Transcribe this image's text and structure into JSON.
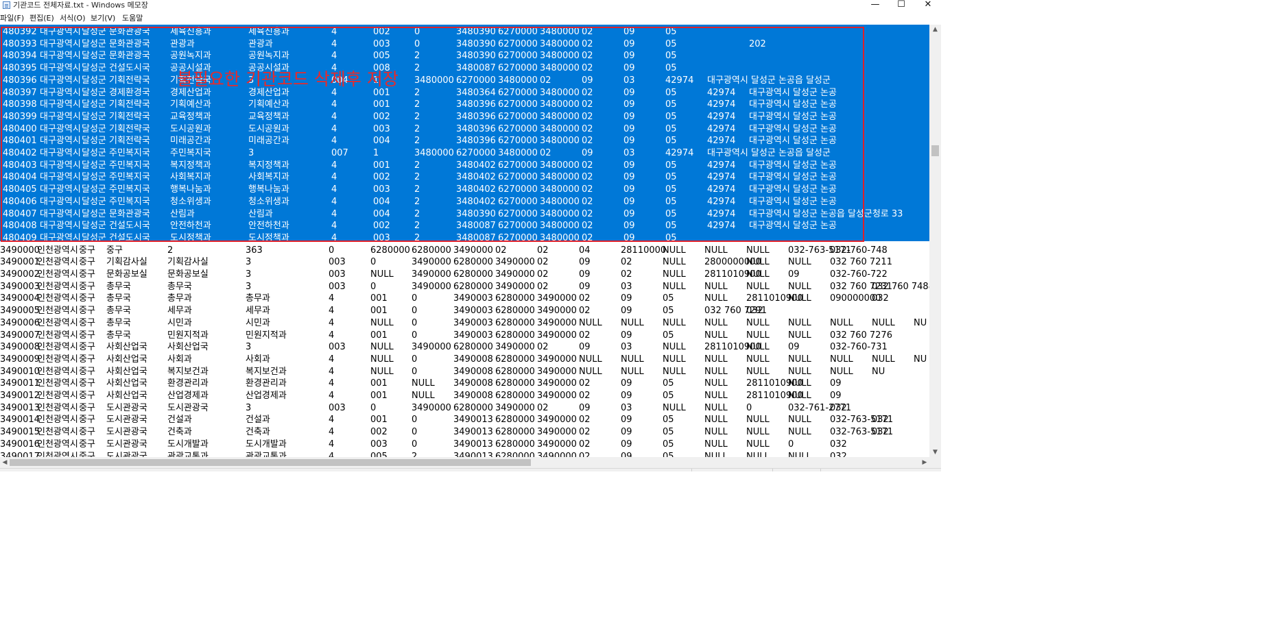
{
  "window": {
    "title": "기관코드 전체자료.txt - Windows 메모장",
    "controls": {
      "minimize": "—",
      "maximize": "☐",
      "close": "✕"
    }
  },
  "menu": [
    "파일(F)",
    "편집(E)",
    "서식(O)",
    "보기(V)",
    "도움말"
  ],
  "annotation": {
    "text": "불필요한 기관코드 삭제후 저장",
    "color": "#e0202a"
  },
  "colors": {
    "selection": "#0078d7",
    "annotation_border": "#e0202a"
  },
  "rows": [
    [
      "480392",
      "대구광역시",
      "달성군",
      "문화관광국",
      "세육진흥과",
      "세육진흥과",
      "4",
      "002",
      "0",
      "3480390",
      "6270000",
      "3480000",
      "02",
      "09",
      "05"
    ],
    [
      "480393",
      "대구광역시",
      "달성군",
      "문화관광국",
      "관광과",
      "관광과",
      "4",
      "003",
      "0",
      "3480390",
      "6270000",
      "3480000",
      "02",
      "09",
      "05",
      "",
      "202"
    ],
    [
      "480394",
      "대구광역시",
      "달성군",
      "문화관광국",
      "공원녹지과",
      "공원녹지과",
      "4",
      "005",
      "2",
      "3480390",
      "6270000",
      "3480000",
      "02",
      "09",
      "05"
    ],
    [
      "480395",
      "대구광역시",
      "달성군",
      "건설도시국",
      "공공시설과",
      "공공시설과",
      "4",
      "008",
      "2",
      "3480087",
      "6270000",
      "3480000",
      "02",
      "09",
      "05"
    ],
    [
      "480396",
      "대구광역시",
      "달성군",
      "기획전략국",
      "기획전략국",
      "3",
      "004",
      "1",
      "3480000",
      "6270000",
      "3480000",
      "02",
      "09",
      "03",
      "42974",
      "대구광역시 달성군 논공읍 달성군"
    ],
    [
      "480397",
      "대구광역시",
      "달성군",
      "경제환경국",
      "경제산업과",
      "경제산업과",
      "4",
      "001",
      "2",
      "3480364",
      "6270000",
      "3480000",
      "02",
      "09",
      "05",
      "42974",
      "대구광역시 달성군 논공"
    ],
    [
      "480398",
      "대구광역시",
      "달성군",
      "기획전략국",
      "기획예산과",
      "기획예산과",
      "4",
      "001",
      "2",
      "3480396",
      "6270000",
      "3480000",
      "02",
      "09",
      "05",
      "42974",
      "대구광역시 달성군 논공"
    ],
    [
      "480399",
      "대구광역시",
      "달성군",
      "기획전략국",
      "교육정책과",
      "교육정책과",
      "4",
      "002",
      "2",
      "3480396",
      "6270000",
      "3480000",
      "02",
      "09",
      "05",
      "42974",
      "대구광역시 달성군 논공"
    ],
    [
      "480400",
      "대구광역시",
      "달성군",
      "기획전략국",
      "도시공원과",
      "도시공원과",
      "4",
      "003",
      "2",
      "3480396",
      "6270000",
      "3480000",
      "02",
      "09",
      "05",
      "42974",
      "대구광역시 달성군 논공"
    ],
    [
      "480401",
      "대구광역시",
      "달성군",
      "기획전략국",
      "미래공간과",
      "미래공간과",
      "4",
      "004",
      "2",
      "3480396",
      "6270000",
      "3480000",
      "02",
      "09",
      "05",
      "42974",
      "대구광역시 달성군 논공"
    ],
    [
      "480402",
      "대구광역시",
      "달성군",
      "주민복지국",
      "주민복지국",
      "3",
      "007",
      "1",
      "3480000",
      "6270000",
      "3480000",
      "02",
      "09",
      "03",
      "42974",
      "대구광역시 달성군 논공읍 달성군"
    ],
    [
      "480403",
      "대구광역시",
      "달성군",
      "주민복지국",
      "복지정책과",
      "복지정책과",
      "4",
      "001",
      "2",
      "3480402",
      "6270000",
      "3480000",
      "02",
      "09",
      "05",
      "42974",
      "대구광역시 달성군 논공"
    ],
    [
      "480404",
      "대구광역시",
      "달성군",
      "주민복지국",
      "사회복지과",
      "사회복지과",
      "4",
      "002",
      "2",
      "3480402",
      "6270000",
      "3480000",
      "02",
      "09",
      "05",
      "42974",
      "대구광역시 달성군 논공"
    ],
    [
      "480405",
      "대구광역시",
      "달성군",
      "주민복지국",
      "행복나눔과",
      "행복나눔과",
      "4",
      "003",
      "2",
      "3480402",
      "6270000",
      "3480000",
      "02",
      "09",
      "05",
      "42974",
      "대구광역시 달성군 논공"
    ],
    [
      "480406",
      "대구광역시",
      "달성군",
      "주민복지국",
      "청소위생과",
      "청소위생과",
      "4",
      "004",
      "2",
      "3480402",
      "6270000",
      "3480000",
      "02",
      "09",
      "05",
      "42974",
      "대구광역시 달성군 논공"
    ],
    [
      "480407",
      "대구광역시",
      "달성군",
      "문화관광국",
      "산림과",
      "산림과",
      "4",
      "004",
      "2",
      "3480390",
      "6270000",
      "3480000",
      "02",
      "09",
      "05",
      "42974",
      "대구광역시 달성군 논공읍 달성군청로 33"
    ],
    [
      "480408",
      "대구광역시",
      "달성군",
      "건설도시국",
      "안전하천과",
      "안전하천과",
      "4",
      "002",
      "2",
      "3480087",
      "6270000",
      "3480000",
      "02",
      "09",
      "05",
      "42974",
      "대구광역시 달성군 논공"
    ],
    [
      "480409",
      "대구광역시",
      "달성군",
      "건설도시국",
      "도시정책과",
      "도시정책과",
      "4",
      "003",
      "2",
      "3480087",
      "6270000",
      "3480000",
      "02",
      "09",
      "05"
    ],
    [
      "3490000",
      "인천광역시",
      "중구",
      "중구",
      "2",
      "363",
      "0",
      "6280000",
      "6280000",
      "3490000",
      "02",
      "02",
      "04",
      "28110000",
      "NULL",
      "NULL",
      "NULL",
      "032-763-5171",
      "032-760-748"
    ],
    [
      "3490001",
      "인천광역시",
      "중구",
      "기획감사실",
      "기획감사실",
      "3",
      "003",
      "0",
      "3490000",
      "6280000",
      "3490000",
      "02",
      "09",
      "02",
      "NULL",
      "2800000000",
      "NULL",
      "NULL",
      "032 760 7211"
    ],
    [
      "3490002",
      "인천광역시",
      "중구",
      "문화공보실",
      "문화공보실",
      "3",
      "003",
      "NULL",
      "3490000",
      "6280000",
      "3490000",
      "02",
      "09",
      "02",
      "NULL",
      "2811010900",
      "NULL",
      "09",
      "032-760-722"
    ],
    [
      "3490003",
      "인천광역시",
      "중구",
      "총무국",
      "총무국",
      "3",
      "003",
      "0",
      "3490000",
      "6280000",
      "3490000",
      "02",
      "09",
      "03",
      "NULL",
      "NULL",
      "NULL",
      "NULL",
      "032 760 7231",
      "032 760 7488"
    ],
    [
      "3490004",
      "인천광역시",
      "중구",
      "총무국",
      "총무과",
      "총무과",
      "4",
      "001",
      "0",
      "3490003",
      "6280000",
      "3490000",
      "02",
      "09",
      "05",
      "NULL",
      "2811010900",
      "NULL",
      "090000000",
      "032"
    ],
    [
      "3490005",
      "인천광역시",
      "중구",
      "총무국",
      "세무과",
      "세무과",
      "4",
      "001",
      "0",
      "3490003",
      "6280000",
      "3490000",
      "02",
      "09",
      "05",
      "032 760 7291",
      "032"
    ],
    [
      "3490006",
      "인천광역시",
      "중구",
      "총무국",
      "시민과",
      "시민과",
      "4",
      "NULL",
      "0",
      "3490003",
      "6280000",
      "3490000",
      "NULL",
      "NULL",
      "NULL",
      "NULL",
      "NULL",
      "NULL",
      "NULL",
      "NULL",
      "NU"
    ],
    [
      "3490007",
      "인천광역시",
      "중구",
      "총무국",
      "민원지적과",
      "민원지적과",
      "4",
      "001",
      "0",
      "3490003",
      "6280000",
      "3490000",
      "02",
      "09",
      "05",
      "NULL",
      "NULL",
      "NULL",
      "032 760 7276"
    ],
    [
      "3490008",
      "인천광역시",
      "중구",
      "사회산업국",
      "사회산업국",
      "3",
      "003",
      "NULL",
      "3490000",
      "6280000",
      "3490000",
      "02",
      "09",
      "03",
      "NULL",
      "2811010900",
      "NULL",
      "09",
      "032-760-731"
    ],
    [
      "3490009",
      "인천광역시",
      "중구",
      "사회산업국",
      "사회과",
      "사회과",
      "4",
      "NULL",
      "0",
      "3490008",
      "6280000",
      "3490000",
      "NULL",
      "NULL",
      "NULL",
      "NULL",
      "NULL",
      "NULL",
      "NULL",
      "NULL",
      "NU"
    ],
    [
      "3490010",
      "인천광역시",
      "중구",
      "사회산업국",
      "복지보건과",
      "복지보건과",
      "4",
      "NULL",
      "0",
      "3490008",
      "6280000",
      "3490000",
      "NULL",
      "NULL",
      "NULL",
      "NULL",
      "NULL",
      "NULL",
      "NULL",
      "NU"
    ],
    [
      "3490011",
      "인천광역시",
      "중구",
      "사회산업국",
      "환경관리과",
      "환경관리과",
      "4",
      "001",
      "NULL",
      "3490008",
      "6280000",
      "3490000",
      "02",
      "09",
      "05",
      "NULL",
      "2811010900",
      "NULL",
      "09"
    ],
    [
      "3490012",
      "인천광역시",
      "중구",
      "사회산업국",
      "산업경제과",
      "산업경제과",
      "4",
      "001",
      "NULL",
      "3490008",
      "6280000",
      "3490000",
      "02",
      "09",
      "05",
      "NULL",
      "2811010900",
      "NULL",
      "09"
    ],
    [
      "3490013",
      "인천광역시",
      "중구",
      "도시관광국",
      "도시관광국",
      "3",
      "003",
      "0",
      "3490000",
      "6280000",
      "3490000",
      "02",
      "09",
      "03",
      "NULL",
      "NULL",
      "0",
      "032-761-2771",
      "032"
    ],
    [
      "3490014",
      "인천광역시",
      "중구",
      "도시관광국",
      "건설과",
      "건설과",
      "4",
      "001",
      "0",
      "3490013",
      "6280000",
      "3490000",
      "02",
      "09",
      "05",
      "NULL",
      "NULL",
      "NULL",
      "032-763-5171",
      "032"
    ],
    [
      "3490015",
      "인천광역시",
      "중구",
      "도시관광국",
      "건축과",
      "건축과",
      "4",
      "002",
      "0",
      "3490013",
      "6280000",
      "3490000",
      "02",
      "09",
      "05",
      "NULL",
      "NULL",
      "NULL",
      "032-763-5171",
      "032"
    ],
    [
      "3490016",
      "인천광역시",
      "중구",
      "도시관광국",
      "도시개발과",
      "도시개발과",
      "4",
      "003",
      "0",
      "3490013",
      "6280000",
      "3490000",
      "02",
      "09",
      "05",
      "NULL",
      "NULL",
      "0",
      "032"
    ],
    [
      "3490017",
      "인천광역시",
      "중구",
      "도시관광국",
      "관광교통과",
      "관광교통과",
      "4",
      "005",
      "2",
      "3490013",
      "6280000",
      "3490000",
      "02",
      "09",
      "05",
      "NULL",
      "NULL",
      "NULL",
      "032"
    ]
  ]
}
